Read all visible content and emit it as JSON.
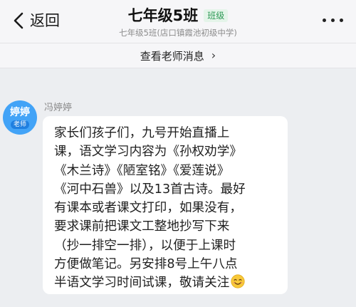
{
  "nav": {
    "back_label": "返回",
    "title": "七年级5班",
    "badge": "班级",
    "subtitle": "七年级5班(店口镇霞池初级中学)"
  },
  "teacher_bar": {
    "label": "查看老师消息",
    "chevron": "›"
  },
  "message": {
    "sender": "冯婷婷",
    "avatar_name": "婷婷",
    "avatar_role": "老师",
    "avatar_color": "#42a3f7",
    "lines": [
      "家长们孩子们，九号开始直播上",
      "课，语文学习内容为《孙权劝学》",
      "《木兰诗》《陋室铭》《爱莲说》",
      "《河中石兽》以及13首古诗。最好",
      "有课本或者课文打印，如果没有，",
      "要求课前把课文工整地抄写下来",
      "（抄一排空一排），以便于上课时",
      "方便做笔记。另安排8号上午八点",
      "半语文学习时间试课，敬请关注"
    ],
    "emoji": "smile-icon"
  },
  "colors": {
    "background": "#eceef1",
    "header": "#f6f6f8",
    "badge_text": "#2f9a57",
    "badge_bg": "#e4f4e9",
    "bubble": "#ffffff"
  }
}
